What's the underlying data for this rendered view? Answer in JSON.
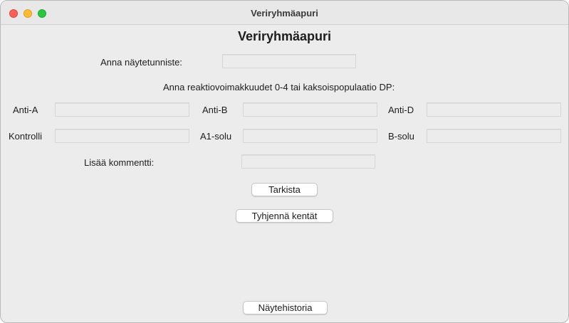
{
  "window": {
    "title": "Veriryhmäapuri"
  },
  "main": {
    "heading": "Veriryhmäapuri",
    "sample_id_label": "Anna näytetunniste:",
    "sample_id_value": "",
    "instruction": "Anna reaktiovoimakkuudet 0-4 tai kaksoispopulaatio DP:",
    "fields": {
      "anti_a": {
        "label": "Anti-A",
        "value": ""
      },
      "anti_b": {
        "label": "Anti-B",
        "value": ""
      },
      "anti_d": {
        "label": "Anti-D",
        "value": ""
      },
      "kontrolli": {
        "label": "Kontrolli",
        "value": ""
      },
      "a1_solu": {
        "label": "A1-solu",
        "value": ""
      },
      "b_solu": {
        "label": "B-solu",
        "value": ""
      }
    },
    "comment_label": "Lisää kommentti:",
    "comment_value": "",
    "buttons": {
      "check": "Tarkista",
      "clear": "Tyhjennä kentät",
      "history": "Näytehistoria"
    }
  }
}
